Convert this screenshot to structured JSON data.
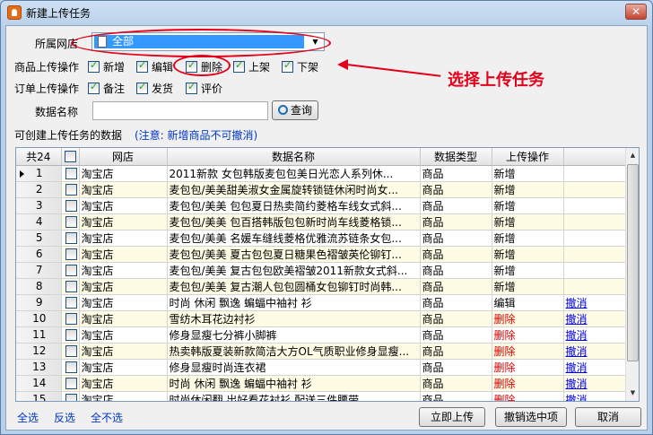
{
  "window": {
    "title": "新建上传任务",
    "close_symbol": "✕"
  },
  "form": {
    "shop_label": "所属网店",
    "shop_value": "全部",
    "product_ops_label": "商品上传操作",
    "product_ops": [
      {
        "label": "新增",
        "checked": true
      },
      {
        "label": "编辑",
        "checked": true
      },
      {
        "label": "删除",
        "checked": true
      },
      {
        "label": "上架",
        "checked": true
      },
      {
        "label": "下架",
        "checked": true
      }
    ],
    "order_ops_label": "订单上传操作",
    "order_ops": [
      {
        "label": "备注",
        "checked": true
      },
      {
        "label": "发货",
        "checked": true
      },
      {
        "label": "评价",
        "checked": true
      }
    ],
    "data_name_label": "数据名称",
    "data_name_value": "",
    "query_button": "查询",
    "creatable_label": "可创建上传任务的数据",
    "note": "(注意: 新增商品不可撤消)"
  },
  "annotation": {
    "text": "选择上传任务"
  },
  "grid": {
    "columns": [
      "共24",
      "",
      "网店",
      "数据名称",
      "数据类型",
      "上传操作",
      ""
    ],
    "rows": [
      {
        "num": "1",
        "shop": "淘宝店",
        "name": "2011新款 女包韩版麦包包美日光恋人系列休...",
        "type": "商品",
        "op": "新增",
        "op_color": "normal",
        "undo": ""
      },
      {
        "num": "2",
        "shop": "淘宝店",
        "name": "麦包包/美美甜美淑女金属旋转锁链休闲时尚女...",
        "type": "商品",
        "op": "新增",
        "op_color": "normal",
        "undo": ""
      },
      {
        "num": "3",
        "shop": "淘宝店",
        "name": "麦包包/美美 包包夏日热卖简约菱格车线女式斜...",
        "type": "商品",
        "op": "新增",
        "op_color": "normal",
        "undo": ""
      },
      {
        "num": "4",
        "shop": "淘宝店",
        "name": "麦包包/美美 包百搭韩版包包新时尚车线菱格锁...",
        "type": "商品",
        "op": "新增",
        "op_color": "normal",
        "undo": ""
      },
      {
        "num": "5",
        "shop": "淘宝店",
        "name": "麦包包/美美 名媛车缝线菱格优雅流苏链条女包...",
        "type": "商品",
        "op": "新增",
        "op_color": "normal",
        "undo": ""
      },
      {
        "num": "6",
        "shop": "淘宝店",
        "name": "麦包包/美美 夏古包包夏日糖果色褶皱英伦铆钉...",
        "type": "商品",
        "op": "新增",
        "op_color": "normal",
        "undo": ""
      },
      {
        "num": "7",
        "shop": "淘宝店",
        "name": "麦包包/美美 复古包包欧美褶皱2011新款女式斜...",
        "type": "商品",
        "op": "新增",
        "op_color": "normal",
        "undo": ""
      },
      {
        "num": "8",
        "shop": "淘宝店",
        "name": "麦包包/美美 复古潮人包包圆桶女包铆钉时尚韩...",
        "type": "商品",
        "op": "新增",
        "op_color": "normal",
        "undo": ""
      },
      {
        "num": "9",
        "shop": "淘宝店",
        "name": "时尚 休闲 飘逸 蝙蝠中袖衬 衫",
        "type": "商品",
        "op": "编辑",
        "op_color": "normal",
        "undo": "撤消"
      },
      {
        "num": "10",
        "shop": "淘宝店",
        "name": "雪纺木耳花边衬衫",
        "type": "商品",
        "op": "删除",
        "op_color": "red",
        "undo": "撤消"
      },
      {
        "num": "11",
        "shop": "淘宝店",
        "name": "修身显瘦七分裤小脚裤",
        "type": "商品",
        "op": "删除",
        "op_color": "red",
        "undo": "撤消"
      },
      {
        "num": "12",
        "shop": "淘宝店",
        "name": "热卖韩版夏装新款简洁大方OL气质职业修身显瘦...",
        "type": "商品",
        "op": "删除",
        "op_color": "red",
        "undo": "撤消"
      },
      {
        "num": "13",
        "shop": "淘宝店",
        "name": "修身显瘦时尚连衣裙",
        "type": "商品",
        "op": "删除",
        "op_color": "red",
        "undo": "撤消"
      },
      {
        "num": "14",
        "shop": "淘宝店",
        "name": "时尚 休闲 飘逸 蝙蝠中袖衬 衫",
        "type": "商品",
        "op": "删除",
        "op_color": "red",
        "undo": "撤消"
      },
      {
        "num": "15",
        "shop": "淘宝店",
        "name": "时尚休闲翻 出好看花衬衫 配送三件腰带",
        "type": "商品",
        "op": "删除",
        "op_color": "red",
        "undo": "撤消"
      }
    ]
  },
  "footer": {
    "select_all": "全选",
    "invert": "反选",
    "select_none": "全不选",
    "upload_now": "立即上传",
    "undo_selected": "撤销选中项",
    "cancel": "取消"
  }
}
